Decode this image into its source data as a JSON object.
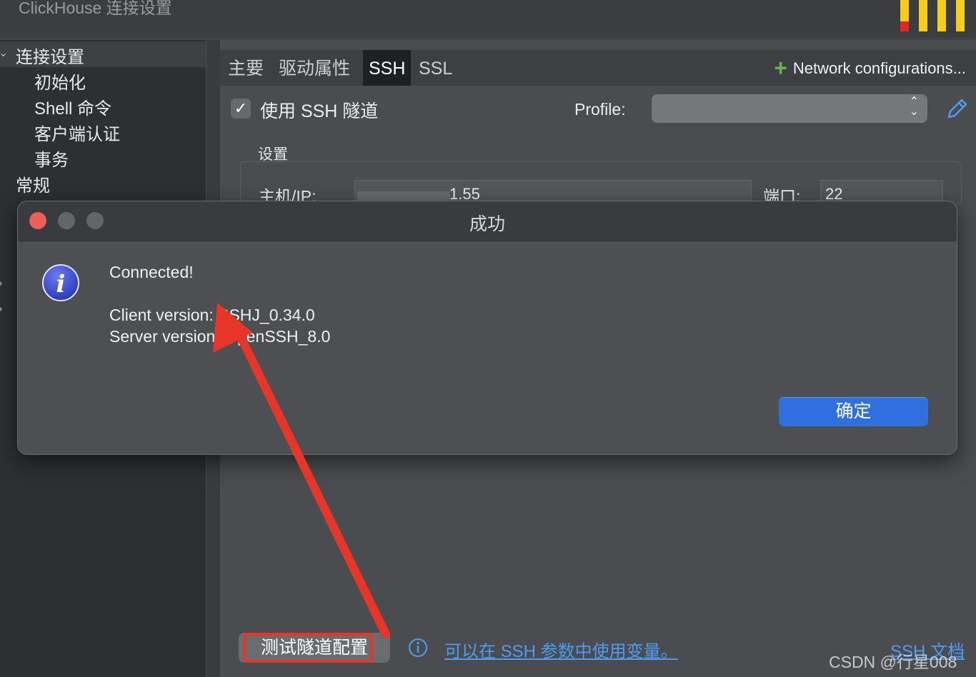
{
  "header": {
    "title": "ClickHouse 连接设置"
  },
  "colors": {
    "arrow": "#e8352a",
    "accent": "#2f6fde",
    "link": "#4d9cf1",
    "add": "#5fb84b"
  },
  "sidebar": {
    "items": [
      {
        "label": "连接设置",
        "level": 0,
        "selected": true
      },
      {
        "label": "初始化",
        "level": 1
      },
      {
        "label": "Shell 命令",
        "level": 1
      },
      {
        "label": "客户端认证",
        "level": 1
      },
      {
        "label": "事务",
        "level": 1
      },
      {
        "label": "常规",
        "level": 0
      }
    ]
  },
  "tabs": [
    {
      "label": "主要"
    },
    {
      "label": "驱动属性"
    },
    {
      "label": "SSH",
      "active": true
    },
    {
      "label": "SSL"
    }
  ],
  "network_config": {
    "label": "Network configurations...",
    "icon": "plus-icon"
  },
  "ssh": {
    "use_tunnel_label": "使用 SSH 隧道",
    "use_tunnel_checked": true,
    "profile_label": "Profile:",
    "profile_value": "",
    "settings_label": "设置",
    "host_label": "主机/IP:",
    "host_value": "1.55",
    "port_label": "端口:",
    "port_value": "22"
  },
  "dialog": {
    "title": "成功",
    "message_line1": "Connected!",
    "message_line2": "Client version: SSHJ_0.34.0",
    "message_line3": "Server version: OpenSSH_8.0",
    "ok_label": "确定",
    "icon": "info-icon"
  },
  "bottom": {
    "test_button_label": "测试隧道配置",
    "hint_link": "可以在 SSH 参数中使用变量。",
    "doc_link": "SSH 文档"
  },
  "watermark": "CSDN @行星008"
}
